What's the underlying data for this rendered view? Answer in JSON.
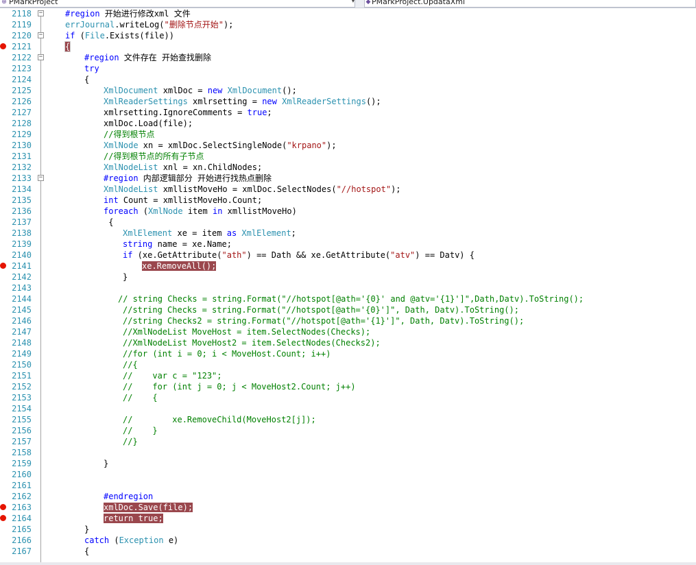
{
  "navigation": {
    "project_combo": "PMarkProject",
    "member_combo": "PMarkProject.UpdataXml"
  },
  "colors": {
    "line_number": "#2b91af",
    "keyword": "#0000ff",
    "type": "#2b91af",
    "string": "#a31515",
    "comment": "#008000",
    "breakpoint": "#e51400",
    "breakpoint_highlight": "#9a474d"
  },
  "icons": {
    "breakpoint": "breakpoint-icon",
    "collapse": "collapse-icon",
    "class": "class-icon",
    "method": "method-icon"
  },
  "editor": {
    "lines": [
      {
        "num": "2118",
        "bp": false,
        "fold": true,
        "indent": 2,
        "tokens": [
          {
            "t": "#region",
            "c": "kw"
          },
          {
            "t": " 开始进行修改xml 文件",
            "c": "pl"
          }
        ]
      },
      {
        "num": "2119",
        "bp": false,
        "fold": false,
        "indent": 2,
        "tokens": [
          {
            "t": "errJournal",
            "c": "ty"
          },
          {
            "t": ".writeLog(",
            "c": "pl"
          },
          {
            "t": "\"删除节点开始\"",
            "c": "st"
          },
          {
            "t": ");",
            "c": "pl"
          }
        ]
      },
      {
        "num": "2120",
        "bp": false,
        "fold": true,
        "indent": 2,
        "tokens": [
          {
            "t": "if",
            "c": "kw"
          },
          {
            "t": " (",
            "c": "pl"
          },
          {
            "t": "File",
            "c": "ty"
          },
          {
            "t": ".Exists(file))",
            "c": "pl"
          }
        ]
      },
      {
        "num": "2121",
        "bp": true,
        "fold": false,
        "indent": 2,
        "tokens": [
          {
            "t": "{",
            "c": "hlb"
          }
        ]
      },
      {
        "num": "2122",
        "bp": false,
        "fold": true,
        "indent": 3,
        "tokens": [
          {
            "t": "#region",
            "c": "kw"
          },
          {
            "t": " 文件存在 开始查找删除",
            "c": "pl"
          }
        ]
      },
      {
        "num": "2123",
        "bp": false,
        "fold": false,
        "indent": 3,
        "tokens": [
          {
            "t": "try",
            "c": "kw"
          }
        ]
      },
      {
        "num": "2124",
        "bp": false,
        "fold": false,
        "indent": 3,
        "tokens": [
          {
            "t": "{",
            "c": "pl"
          }
        ]
      },
      {
        "num": "2125",
        "bp": false,
        "fold": false,
        "indent": 4,
        "tokens": [
          {
            "t": "XmlDocument",
            "c": "ty"
          },
          {
            "t": " xmlDoc = ",
            "c": "pl"
          },
          {
            "t": "new",
            "c": "kw"
          },
          {
            "t": " ",
            "c": "pl"
          },
          {
            "t": "XmlDocument",
            "c": "ty"
          },
          {
            "t": "();",
            "c": "pl"
          }
        ]
      },
      {
        "num": "2126",
        "bp": false,
        "fold": false,
        "indent": 4,
        "tokens": [
          {
            "t": "XmlReaderSettings",
            "c": "ty"
          },
          {
            "t": " xmlrsetting = ",
            "c": "pl"
          },
          {
            "t": "new",
            "c": "kw"
          },
          {
            "t": " ",
            "c": "pl"
          },
          {
            "t": "XmlReaderSettings",
            "c": "ty"
          },
          {
            "t": "();",
            "c": "pl"
          }
        ]
      },
      {
        "num": "2127",
        "bp": false,
        "fold": false,
        "indent": 4,
        "tokens": [
          {
            "t": "xmlrsetting.IgnoreComments = ",
            "c": "pl"
          },
          {
            "t": "true",
            "c": "kw"
          },
          {
            "t": ";",
            "c": "pl"
          }
        ]
      },
      {
        "num": "2128",
        "bp": false,
        "fold": false,
        "indent": 4,
        "tokens": [
          {
            "t": "xmlDoc.Load(file);",
            "c": "pl"
          }
        ]
      },
      {
        "num": "2129",
        "bp": false,
        "fold": false,
        "indent": 4,
        "tokens": [
          {
            "t": "//得到根节点",
            "c": "cm"
          }
        ]
      },
      {
        "num": "2130",
        "bp": false,
        "fold": false,
        "indent": 4,
        "tokens": [
          {
            "t": "XmlNode",
            "c": "ty"
          },
          {
            "t": " xn = xmlDoc.SelectSingleNode(",
            "c": "pl"
          },
          {
            "t": "\"krpano\"",
            "c": "st"
          },
          {
            "t": ");",
            "c": "pl"
          }
        ]
      },
      {
        "num": "2131",
        "bp": false,
        "fold": false,
        "indent": 4,
        "tokens": [
          {
            "t": "//得到根节点的所有子节点",
            "c": "cm"
          }
        ]
      },
      {
        "num": "2132",
        "bp": false,
        "fold": false,
        "indent": 4,
        "tokens": [
          {
            "t": "XmlNodeList",
            "c": "ty"
          },
          {
            "t": " xnl = xn.ChildNodes;",
            "c": "pl"
          }
        ]
      },
      {
        "num": "2133",
        "bp": false,
        "fold": true,
        "indent": 4,
        "tokens": [
          {
            "t": "#region",
            "c": "kw"
          },
          {
            "t": " 内部逻辑部分 开始进行找热点删除",
            "c": "pl"
          }
        ]
      },
      {
        "num": "2134",
        "bp": false,
        "fold": false,
        "indent": 4,
        "tokens": [
          {
            "t": "XmlNodeList",
            "c": "ty"
          },
          {
            "t": " xmllistMoveHo = xmlDoc.SelectNodes(",
            "c": "pl"
          },
          {
            "t": "\"//hotspot\"",
            "c": "st"
          },
          {
            "t": ");",
            "c": "pl"
          }
        ]
      },
      {
        "num": "2135",
        "bp": false,
        "fold": false,
        "indent": 4,
        "tokens": [
          {
            "t": "int",
            "c": "kw"
          },
          {
            "t": " Count = xmllistMoveHo.Count;",
            "c": "pl"
          }
        ]
      },
      {
        "num": "2136",
        "bp": false,
        "fold": false,
        "indent": 4,
        "tokens": [
          {
            "t": "foreach",
            "c": "kw"
          },
          {
            "t": " (",
            "c": "pl"
          },
          {
            "t": "XmlNode",
            "c": "ty"
          },
          {
            "t": " item ",
            "c": "pl"
          },
          {
            "t": "in",
            "c": "kw"
          },
          {
            "t": " xmllistMoveHo)",
            "c": "pl"
          }
        ]
      },
      {
        "num": "2137",
        "bp": false,
        "fold": false,
        "indent": 4,
        "tokens": [
          {
            "t": " {",
            "c": "pl"
          }
        ]
      },
      {
        "num": "2138",
        "bp": false,
        "fold": false,
        "indent": 5,
        "tokens": [
          {
            "t": "XmlElement",
            "c": "ty"
          },
          {
            "t": " xe = item ",
            "c": "pl"
          },
          {
            "t": "as",
            "c": "kw"
          },
          {
            "t": " ",
            "c": "pl"
          },
          {
            "t": "XmlElement",
            "c": "ty"
          },
          {
            "t": ";",
            "c": "pl"
          }
        ]
      },
      {
        "num": "2139",
        "bp": false,
        "fold": false,
        "indent": 5,
        "tokens": [
          {
            "t": "string",
            "c": "kw"
          },
          {
            "t": " name = xe.Name;",
            "c": "pl"
          }
        ]
      },
      {
        "num": "2140",
        "bp": false,
        "fold": false,
        "indent": 5,
        "tokens": [
          {
            "t": "if",
            "c": "kw"
          },
          {
            "t": " (xe.GetAttribute(",
            "c": "pl"
          },
          {
            "t": "\"ath\"",
            "c": "st"
          },
          {
            "t": ") == Dath && xe.GetAttribute(",
            "c": "pl"
          },
          {
            "t": "\"atv\"",
            "c": "st"
          },
          {
            "t": ") == Datv) {",
            "c": "pl"
          }
        ]
      },
      {
        "num": "2141",
        "bp": true,
        "fold": false,
        "indent": 6,
        "tokens": [
          {
            "t": "xe.RemoveAll();",
            "c": "hl"
          }
        ]
      },
      {
        "num": "2142",
        "bp": false,
        "fold": false,
        "indent": 5,
        "tokens": [
          {
            "t": "}",
            "c": "pl"
          }
        ]
      },
      {
        "num": "2143",
        "bp": false,
        "fold": false,
        "indent": 5,
        "tokens": []
      },
      {
        "num": "2144",
        "bp": false,
        "fold": false,
        "indent": 5,
        "tokens": [
          {
            "t": "// string Checks = string.Format(\"//hotspot[@ath='{0}' and @atv='{1}']\",Dath,Datv).ToString();",
            "c": "cm"
          }
        ],
        "offset": -1
      },
      {
        "num": "2145",
        "bp": false,
        "fold": false,
        "indent": 5,
        "tokens": [
          {
            "t": "//string Checks = string.Format(\"//hotspot[@ath='{0}']\", Dath, Datv).ToString();",
            "c": "cm"
          }
        ]
      },
      {
        "num": "2146",
        "bp": false,
        "fold": false,
        "indent": 5,
        "tokens": [
          {
            "t": "//string Checks2 = string.Format(\"//hotspot[@ath='{1}']\", Dath, Datv).ToString();",
            "c": "cm"
          }
        ]
      },
      {
        "num": "2147",
        "bp": false,
        "fold": false,
        "indent": 5,
        "tokens": [
          {
            "t": "//XmlNodeList MoveHost = item.SelectNodes(Checks);",
            "c": "cm"
          }
        ]
      },
      {
        "num": "2148",
        "bp": false,
        "fold": false,
        "indent": 5,
        "tokens": [
          {
            "t": "//XmlNodeList MoveHost2 = item.SelectNodes(Checks2);",
            "c": "cm"
          }
        ]
      },
      {
        "num": "2149",
        "bp": false,
        "fold": false,
        "indent": 5,
        "tokens": [
          {
            "t": "//for (int i = 0; i < MoveHost.Count; i++)",
            "c": "cm"
          }
        ]
      },
      {
        "num": "2150",
        "bp": false,
        "fold": false,
        "indent": 5,
        "tokens": [
          {
            "t": "//{",
            "c": "cm"
          }
        ]
      },
      {
        "num": "2151",
        "bp": false,
        "fold": false,
        "indent": 5,
        "tokens": [
          {
            "t": "//    var c = \"123\";",
            "c": "cm"
          }
        ]
      },
      {
        "num": "2152",
        "bp": false,
        "fold": false,
        "indent": 5,
        "tokens": [
          {
            "t": "//    for (int j = 0; j < MoveHost2.Count; j++)",
            "c": "cm"
          }
        ]
      },
      {
        "num": "2153",
        "bp": false,
        "fold": false,
        "indent": 5,
        "tokens": [
          {
            "t": "//    {",
            "c": "cm"
          }
        ]
      },
      {
        "num": "2154",
        "bp": false,
        "fold": false,
        "indent": 5,
        "tokens": []
      },
      {
        "num": "2155",
        "bp": false,
        "fold": false,
        "indent": 5,
        "tokens": [
          {
            "t": "//        xe.RemoveChild(MoveHost2[j]);",
            "c": "cm"
          }
        ]
      },
      {
        "num": "2156",
        "bp": false,
        "fold": false,
        "indent": 5,
        "tokens": [
          {
            "t": "//    }",
            "c": "cm"
          }
        ]
      },
      {
        "num": "2157",
        "bp": false,
        "fold": false,
        "indent": 5,
        "tokens": [
          {
            "t": "//}",
            "c": "cm"
          }
        ]
      },
      {
        "num": "2158",
        "bp": false,
        "fold": false,
        "indent": 5,
        "tokens": []
      },
      {
        "num": "2159",
        "bp": false,
        "fold": false,
        "indent": 4,
        "tokens": [
          {
            "t": "}",
            "c": "pl"
          }
        ]
      },
      {
        "num": "2160",
        "bp": false,
        "fold": false,
        "indent": 4,
        "tokens": []
      },
      {
        "num": "2161",
        "bp": false,
        "fold": false,
        "indent": 4,
        "tokens": []
      },
      {
        "num": "2162",
        "bp": false,
        "fold": false,
        "indent": 4,
        "tokens": [
          {
            "t": "#endregion",
            "c": "kw"
          }
        ]
      },
      {
        "num": "2163",
        "bp": true,
        "fold": false,
        "indent": 4,
        "tokens": [
          {
            "t": "xmlDoc.Save(file);",
            "c": "hl"
          }
        ]
      },
      {
        "num": "2164",
        "bp": true,
        "fold": false,
        "indent": 4,
        "tokens": [
          {
            "t": "return true;",
            "c": "hl"
          }
        ]
      },
      {
        "num": "2165",
        "bp": false,
        "fold": false,
        "indent": 3,
        "tokens": [
          {
            "t": "}",
            "c": "pl"
          }
        ]
      },
      {
        "num": "2166",
        "bp": false,
        "fold": false,
        "indent": 3,
        "tokens": [
          {
            "t": "catch",
            "c": "kw"
          },
          {
            "t": " (",
            "c": "pl"
          },
          {
            "t": "Exception",
            "c": "ty"
          },
          {
            "t": " e)",
            "c": "pl"
          }
        ]
      },
      {
        "num": "2167",
        "bp": false,
        "fold": false,
        "indent": 3,
        "tokens": [
          {
            "t": "{",
            "c": "pl"
          }
        ]
      }
    ]
  }
}
